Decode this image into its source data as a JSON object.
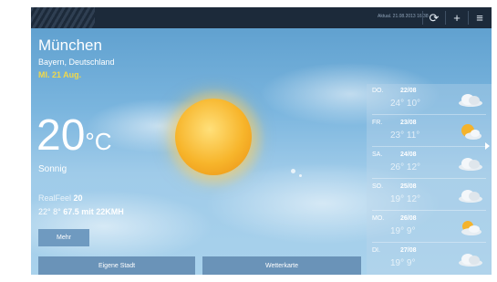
{
  "topbar": {
    "updated": "Aktual. 21.08.2013 16:38",
    "refresh_icon": "refresh-icon",
    "add_icon": "plus-icon",
    "menu_icon": "menu-icon"
  },
  "location": {
    "city": "München",
    "region": "Bayern, Deutschland",
    "date": "MI. 21 Aug."
  },
  "current": {
    "temperature": "20",
    "unit": "°C",
    "condition": "Sonnig",
    "realfeel_label": "RealFeel",
    "realfeel_value": "20",
    "hi_lo": "22°  8°",
    "wind": "67.5 mit 22KMH",
    "more_label": "Mehr",
    "icon": "sun-icon"
  },
  "buttons": {
    "own_city": "Eigene Stadt",
    "weather_map": "Wetterkarte"
  },
  "forecast": [
    {
      "day": "DO.",
      "date": "22/08",
      "temps": "24° 10°",
      "icon": "cloud-icon"
    },
    {
      "day": "FR.",
      "date": "23/08",
      "temps": "23° 11°",
      "icon": "sun-cloud-icon"
    },
    {
      "day": "SA.",
      "date": "24/08",
      "temps": "26° 12°",
      "icon": "cloud-icon"
    },
    {
      "day": "SO.",
      "date": "25/08",
      "temps": "19° 12°",
      "icon": "cloud-icon"
    },
    {
      "day": "MO.",
      "date": "26/08",
      "temps": "19° 9°",
      "icon": "sun-cloud-icon"
    },
    {
      "day": "DI.",
      "date": "27/08",
      "temps": "19° 9°",
      "icon": "cloud-icon"
    }
  ],
  "colors": {
    "topbar": "#1c2a3a",
    "date_accent": "#f1d84a",
    "button": "#6a93b8"
  }
}
